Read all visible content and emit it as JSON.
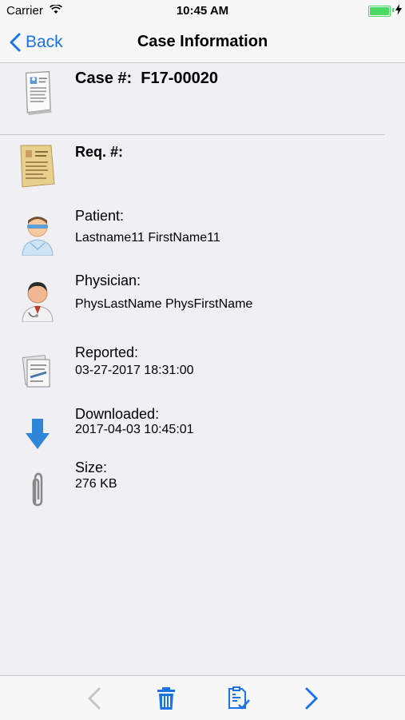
{
  "status_bar": {
    "carrier": "Carrier",
    "time": "10:45 AM"
  },
  "nav": {
    "back_label": "Back",
    "title": "Case Information"
  },
  "case": {
    "label": "Case #:",
    "number": "F17-00020"
  },
  "req": {
    "label": "Req. #:"
  },
  "patient": {
    "label": "Patient:",
    "value": "Lastname11 FirstName11"
  },
  "physician": {
    "label": "Physician:",
    "value": "PhysLastName PhysFirstName"
  },
  "reported": {
    "label": "Reported:",
    "value": "03-27-2017 18:31:00"
  },
  "downloaded": {
    "label": "Downloaded:",
    "value": "2017-04-03 10:45:01"
  },
  "size": {
    "label": "Size:",
    "value": "276 KB"
  },
  "toolbar": {
    "icons": [
      "chevron-left-icon",
      "trash-icon",
      "report-check-icon",
      "chevron-right-icon"
    ]
  },
  "colors": {
    "accent": "#1a73e8",
    "battery": "#4cd964",
    "background": "#efeff4"
  }
}
